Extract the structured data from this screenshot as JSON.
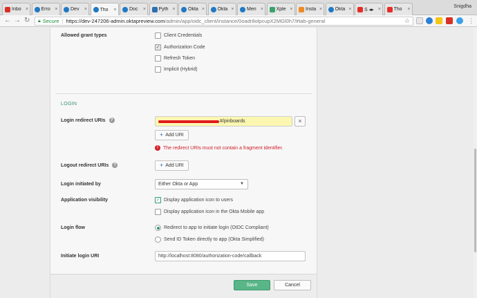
{
  "browser": {
    "tabs": [
      {
        "title": "Inbo",
        "icon": "gmail-icon",
        "color": "#d93025"
      },
      {
        "title": "Erro",
        "icon": "okta-icon",
        "color": "#1f79c4"
      },
      {
        "title": "Dev",
        "icon": "okta-icon",
        "color": "#1f79c4"
      },
      {
        "title": "Tho",
        "icon": "okta-icon",
        "color": "#1f79c4"
      },
      {
        "title": "Doc",
        "icon": "okta-icon",
        "color": "#1f79c4"
      },
      {
        "title": "Pyth",
        "icon": "python-icon",
        "color": "#2e6fb0"
      },
      {
        "title": "Okta",
        "icon": "okta-icon",
        "color": "#1f79c4"
      },
      {
        "title": "Okta",
        "icon": "okta-icon",
        "color": "#1f79c4"
      },
      {
        "title": "Men",
        "icon": "okta-icon",
        "color": "#1f79c4"
      },
      {
        "title": "Xple",
        "icon": "xplenty-icon",
        "color": "#3ba36a"
      },
      {
        "title": "Insta",
        "icon": "carrot-icon",
        "color": "#f08a24"
      },
      {
        "title": "Okta",
        "icon": "okta-icon",
        "color": "#1f79c4"
      },
      {
        "title": "S ◂▸",
        "icon": "youtube-icon",
        "color": "#e52d27"
      },
      {
        "title": "Tho",
        "icon": "youtube-icon",
        "color": "#e52d27"
      }
    ],
    "user": "Snigdha",
    "secure_label": "Secure",
    "url_host": "https://dev-247206-admin.oktapreview.com",
    "url_path": "/admin/app/oidc_client/instance/0oadr8olpcupX2MGl0h7/#tab-general"
  },
  "grant_types": {
    "label": "Allowed grant types",
    "options": [
      {
        "label": "Client Credentials",
        "checked": false
      },
      {
        "label": "Authorization Code",
        "checked": true
      },
      {
        "label": "Refresh Token",
        "checked": false
      },
      {
        "label": "Implicit (Hybrid)",
        "checked": false
      }
    ]
  },
  "login": {
    "section_title": "LOGIN",
    "redirect_label": "Login redirect URIs",
    "redirect_value_suffix": "#/pinboards",
    "add_uri_label": "Add URI",
    "error_text": "The redirect URIs must not contain a fragment identifier.",
    "logout_label": "Logout redirect URIs",
    "initiated_label": "Login initiated by",
    "initiated_value": "Either Okta or App",
    "visibility_label": "Application visibility",
    "visibility_options": [
      {
        "label": "Display application icon to users",
        "checked": true
      },
      {
        "label": "Display application icon in the Okta Mobile app",
        "checked": false
      }
    ],
    "flow_label": "Login flow",
    "flow_options": [
      {
        "label": "Redirect to app to initiate login (OIDC Compliant)",
        "selected": true
      },
      {
        "label": "Send ID Token directly to app (Okta Simplified)",
        "selected": false
      }
    ],
    "initiate_uri_label": "Initiate login URI",
    "initiate_uri_value": "http://localhost:8080/authorization-code/callback"
  },
  "footer": {
    "save_label": "Save",
    "cancel_label": "Cancel"
  },
  "colors": {
    "accent_green": "#58b687",
    "error_red": "#d0202a",
    "highlight_yellow": "#fbf7b0"
  }
}
